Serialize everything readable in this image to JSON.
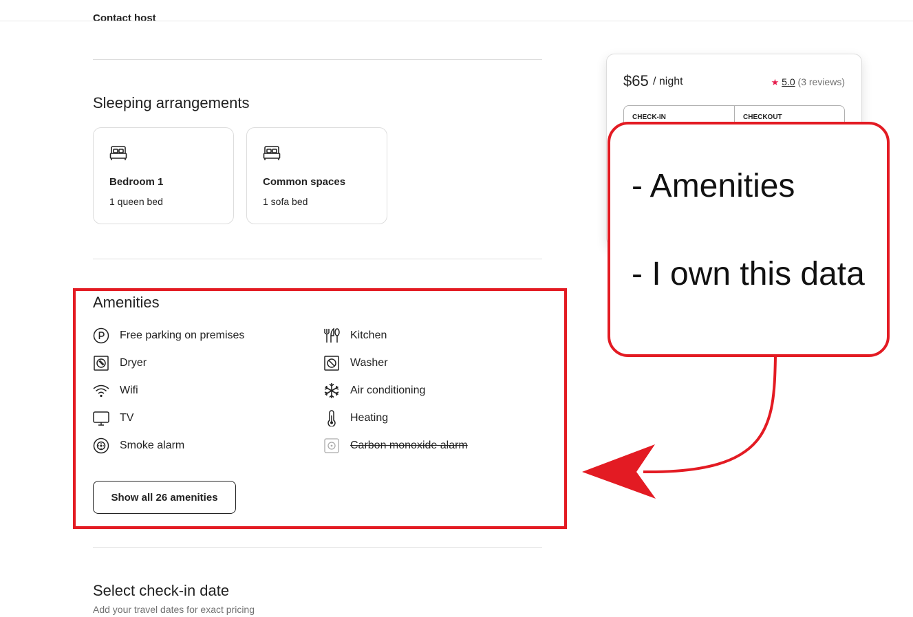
{
  "header": {
    "contact_host": "Contact host"
  },
  "sleeping": {
    "title": "Sleeping arrangements",
    "rooms": [
      {
        "name": "Bedroom 1",
        "beds": "1 queen bed",
        "icon": "bed-icon"
      },
      {
        "name": "Common spaces",
        "beds": "1 sofa bed",
        "icon": "bed-icon"
      }
    ]
  },
  "amenities": {
    "title": "Amenities",
    "items": [
      {
        "label": "Free parking on premises",
        "icon": "parking-icon",
        "available": true
      },
      {
        "label": "Kitchen",
        "icon": "kitchen-utensils-icon",
        "available": true
      },
      {
        "label": "Dryer",
        "icon": "dryer-icon",
        "available": true
      },
      {
        "label": "Washer",
        "icon": "washer-icon",
        "available": true
      },
      {
        "label": "Wifi",
        "icon": "wifi-icon",
        "available": true
      },
      {
        "label": "Air conditioning",
        "icon": "snowflake-icon",
        "available": true
      },
      {
        "label": "TV",
        "icon": "tv-icon",
        "available": true
      },
      {
        "label": "Heating",
        "icon": "thermometer-icon",
        "available": true
      },
      {
        "label": "Smoke alarm",
        "icon": "smoke-alarm-icon",
        "available": true
      },
      {
        "label": "Carbon monoxide alarm",
        "icon": "co-alarm-icon",
        "available": false
      }
    ],
    "show_all_label": "Show all 26 amenities"
  },
  "checkin": {
    "title": "Select check-in date",
    "subtitle": "Add your travel dates for exact pricing"
  },
  "booking": {
    "price": "$65",
    "per_night": "/ night",
    "rating": "5.0",
    "reviews": "(3 reviews)",
    "checkin_label": "CHECK-IN",
    "checkout_label": "CHECKOUT"
  },
  "annotation": {
    "lines": [
      "- Amenities",
      "- I own this data"
    ],
    "color": "#e31b23"
  },
  "colors": {
    "accent_red": "#e31b23",
    "star": "#e61e4d",
    "text": "#222222",
    "muted": "#717171"
  }
}
